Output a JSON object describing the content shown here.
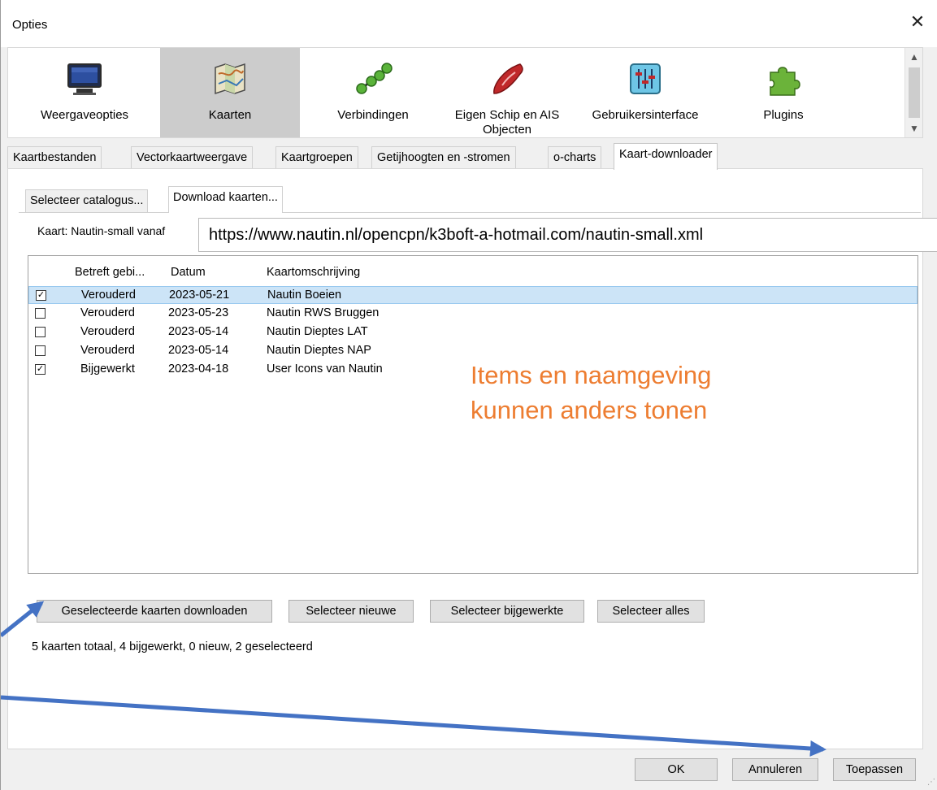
{
  "window": {
    "title": "Opties"
  },
  "toolbar": {
    "items": [
      {
        "label": "Weergaveopties",
        "icon": "monitor-icon"
      },
      {
        "label": "Kaarten",
        "icon": "map-icon",
        "selected": true
      },
      {
        "label": "Verbindingen",
        "icon": "connections-icon"
      },
      {
        "label": "Eigen Schip en AIS Objecten",
        "icon": "ship-icon"
      },
      {
        "label": "Gebruikersinterface",
        "icon": "sliders-icon"
      },
      {
        "label": "Plugins",
        "icon": "puzzle-icon"
      }
    ]
  },
  "tabs": [
    {
      "label": "Kaartbestanden"
    },
    {
      "label": "Vectorkaartweergave"
    },
    {
      "label": "Kaartgroepen"
    },
    {
      "label": "Getijhoogten en -stromen"
    },
    {
      "label": "o-charts"
    },
    {
      "label": "Kaart-downloader",
      "active": true
    }
  ],
  "subtabs": [
    {
      "label": "Selecteer catalogus..."
    },
    {
      "label": "Download kaarten...",
      "active": true
    }
  ],
  "chart_source": {
    "label": "Kaart: Nautin-small vanaf",
    "url": "https://www.nautin.nl/opencpn/k3boft-a-hotmail.com/nautin-small.xml"
  },
  "list": {
    "columns": [
      "Betreft gebi...",
      "Datum",
      "Kaartomschrijving"
    ],
    "rows": [
      {
        "checked": true,
        "status": "Verouderd",
        "date": "2023-05-21",
        "description": "Nautin Boeien",
        "selected": true
      },
      {
        "checked": false,
        "status": "Verouderd",
        "date": "2023-05-23",
        "description": "Nautin RWS Bruggen"
      },
      {
        "checked": false,
        "status": "Verouderd",
        "date": "2023-05-14",
        "description": "Nautin Dieptes LAT"
      },
      {
        "checked": false,
        "status": "Verouderd",
        "date": "2023-05-14",
        "description": "Nautin Dieptes NAP"
      },
      {
        "checked": true,
        "status": "Bijgewerkt",
        "date": "2023-04-18",
        "description": "User Icons van Nautin"
      }
    ]
  },
  "note": {
    "line1": "Items en naamgeving",
    "line2": "kunnen anders tonen",
    "color": "#ED7D31"
  },
  "actions": {
    "download_selected": "Geselecteerde kaarten downloaden",
    "select_new": "Selecteer nieuwe",
    "select_updated": "Selecteer bijgewerkte",
    "select_all": "Selecteer alles"
  },
  "status": "5 kaarten totaal, 4 bijgewerkt, 0 nieuw, 2 geselecteerd",
  "footer": {
    "ok": "OK",
    "cancel": "Annuleren",
    "apply": "Toepassen"
  },
  "annotation": {
    "arrow_color": "#4472C4"
  }
}
